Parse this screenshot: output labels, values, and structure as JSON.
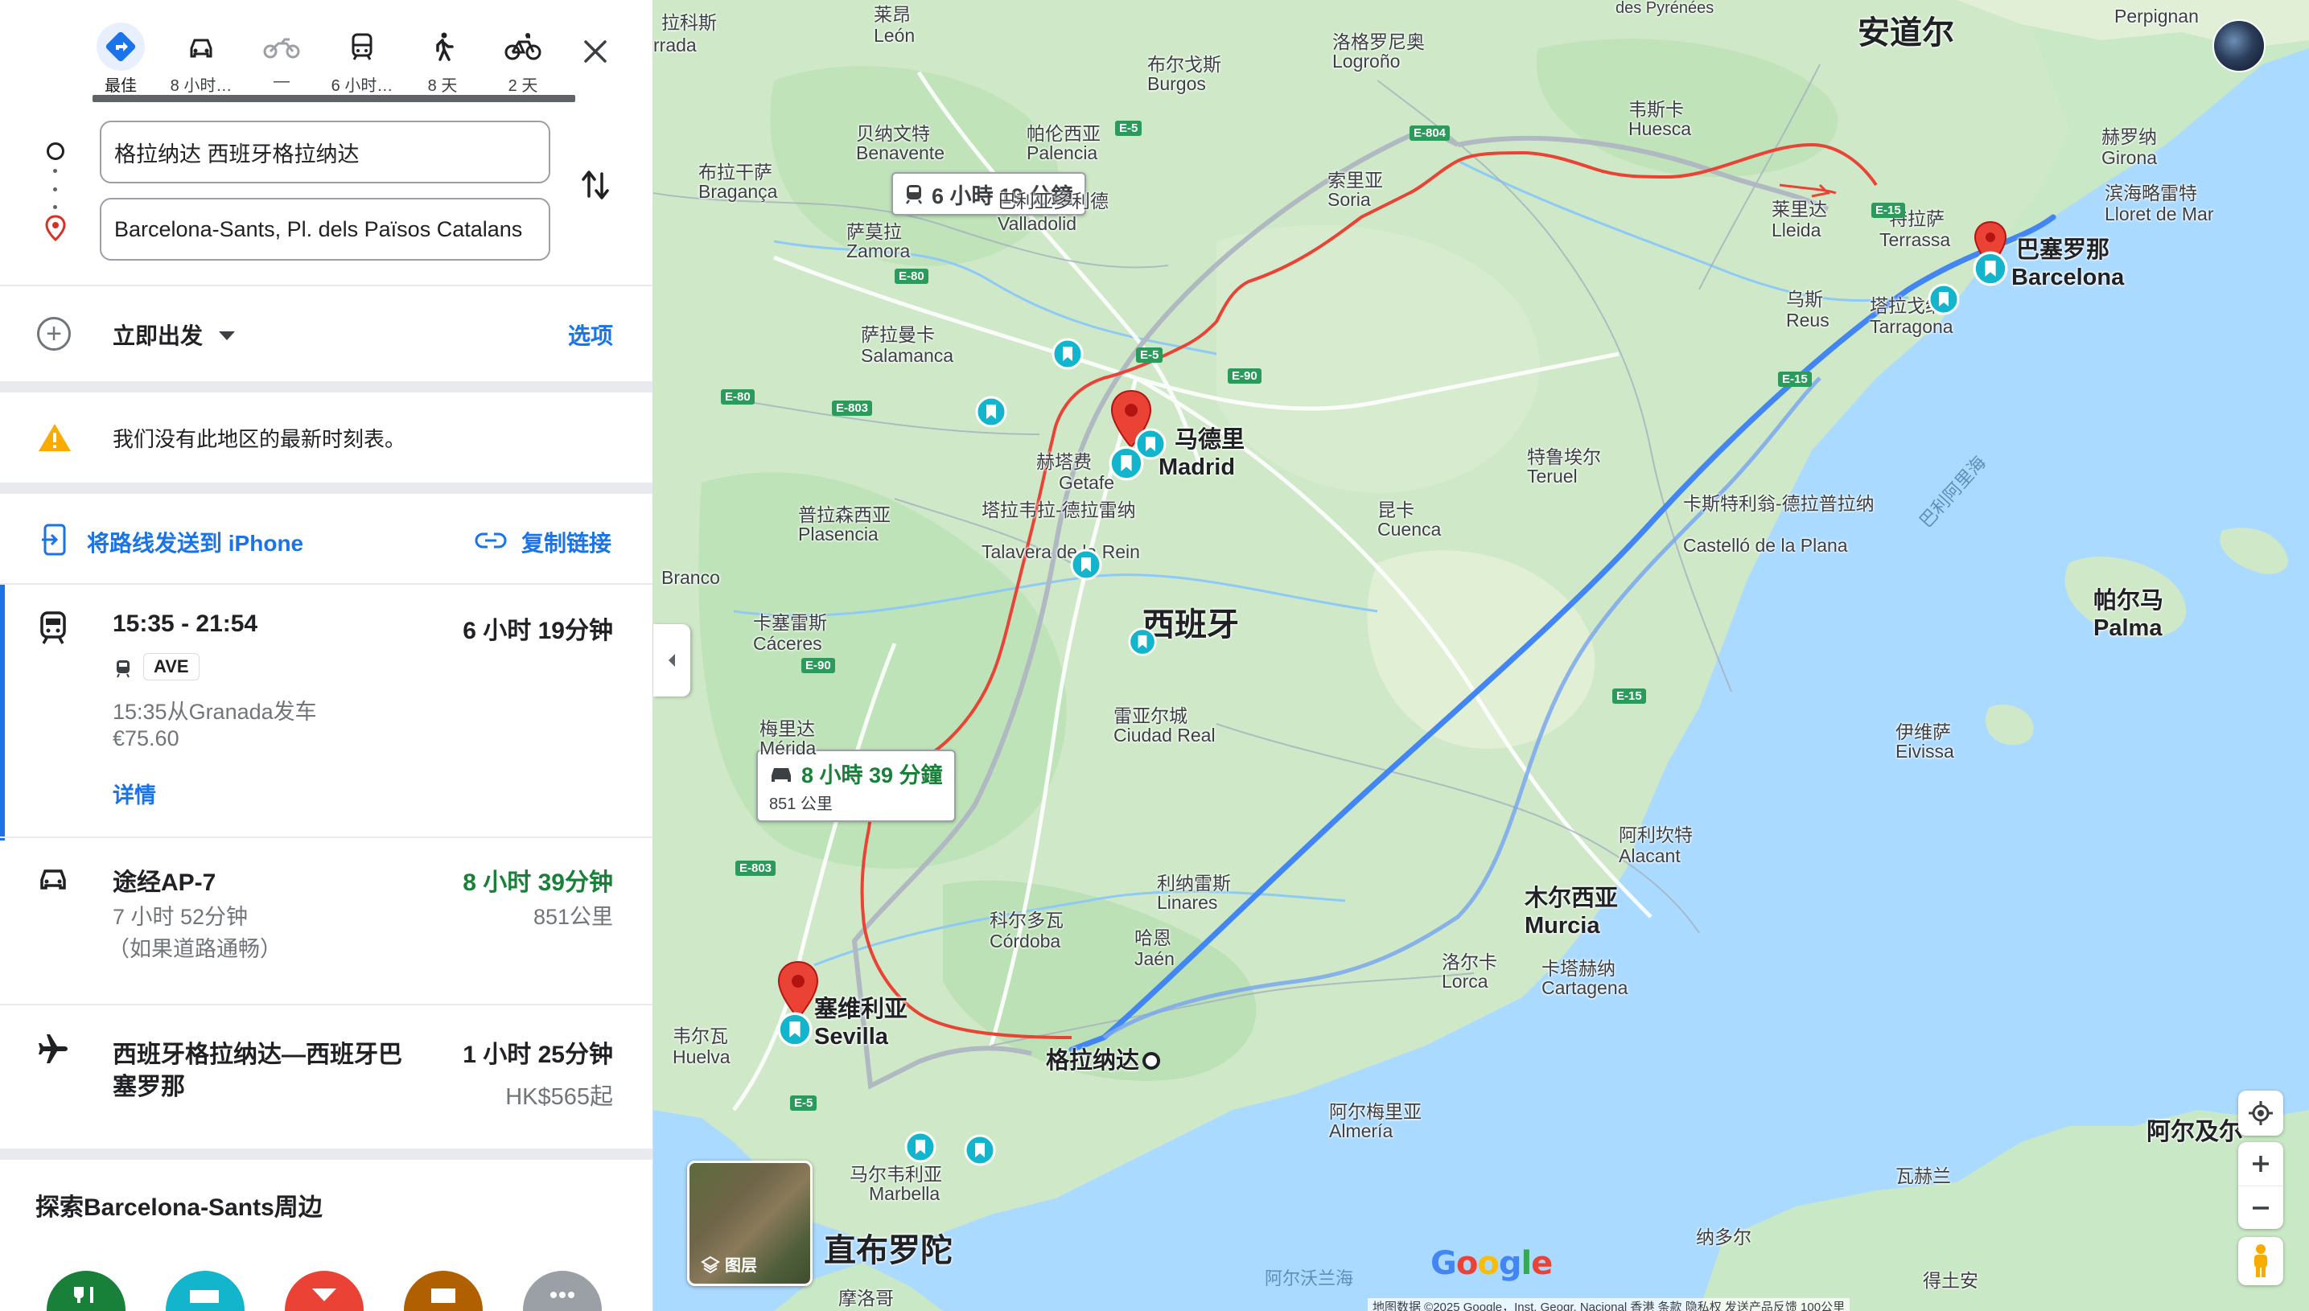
{
  "modes": [
    {
      "label": "最佳",
      "icon": "best-route-icon"
    },
    {
      "label": "8 小时…",
      "icon": "car-icon"
    },
    {
      "label": "—",
      "icon": "motorcycle-icon"
    },
    {
      "label": "6 小时…",
      "icon": "transit-icon"
    },
    {
      "label": "8 天",
      "icon": "walk-icon"
    },
    {
      "label": "2 天",
      "icon": "bicycle-icon"
    }
  ],
  "inputs": {
    "origin": "格拉纳达 西班牙格拉纳达",
    "destination": "Barcelona-Sants, Pl. dels Països Catalans"
  },
  "depart": {
    "label": "立即出发",
    "options_label": "选项"
  },
  "warning": "我们没有此地区的最新时刻表。",
  "share": {
    "send_label": "将路线发送到 iPhone",
    "copy_label": "复制链接"
  },
  "options": [
    {
      "type": "train",
      "title": "15:35 - 21:54",
      "duration": "6 小时 19分钟",
      "badge": "AVE",
      "depart_text": "15:35从Granada发车",
      "price": "€75.60",
      "details_label": "详情"
    },
    {
      "type": "car",
      "title": "途经AP-7",
      "duration": "8 小时 39分钟",
      "sub1": "7 小时 52分钟",
      "sub2": "（如果道路通畅）",
      "distance": "851公里"
    },
    {
      "type": "flight",
      "title_line1": "西班牙格拉纳达—西班牙巴",
      "title_line2": "塞罗那",
      "duration": "1 小时 25分钟",
      "price": "HK$565起"
    }
  ],
  "explore": {
    "title": "探索Barcelona-Sants周边"
  },
  "map": {
    "callout_train": "6 小時 19 分鐘",
    "callout_car_time": "8 小時 39 分鐘",
    "callout_car_distance": "851 公里",
    "layers_label": "图层",
    "attribution": "地图数据 ©2025 Google，Inst. Geogr. Nacional    香港    条款    隐私权    发送产品反馈    100公里",
    "labels": {
      "andorra": "安道尔",
      "spain": "西班牙",
      "gibraltar": "直布罗陀",
      "madrid_cn": "马德里",
      "madrid": "Madrid",
      "barcelona_cn": "巴塞罗那",
      "barcelona": "Barcelona",
      "granada": "格拉纳达",
      "sevilla_cn": "塞维利亚",
      "sevilla": "Sevilla",
      "murcia_cn": "木尔西亚",
      "murcia": "Murcia",
      "palma_cn": "帕尔马",
      "palma": "Palma",
      "valladolid_cn": "巴利亚多利德",
      "valladolid": "Valladolid",
      "cordoba_cn": "科尔多瓦",
      "cordoba": "Córdoba",
      "lleida_cn": "莱里达",
      "lleida": "Lleida",
      "tarragona_cn": "塔拉戈纳",
      "tarragona": "Tarragona",
      "salamanca_cn": "萨拉曼卡",
      "salamanca": "Salamanca",
      "burgos_cn": "布尔戈斯",
      "burgos": "Burgos",
      "logrono_cn": "洛格罗尼奥",
      "logrono": "Logroño",
      "leon_cn": "莱昂",
      "leon": "León",
      "zamora_cn": "萨莫拉",
      "zamora": "Zamora",
      "soria_cn": "索里亚",
      "soria": "Soria",
      "teruel_cn": "特鲁埃尔",
      "teruel": "Teruel",
      "cuenca_cn": "昆卡",
      "cuenca": "Cuenca",
      "castellon_cn": "卡斯特利翁-德拉普拉纳",
      "castellon": "Castelló de la Plana",
      "alacant_cn": "阿利坎特",
      "alacant": "Alacant",
      "lorca_cn": "洛尔卡",
      "lorca": "Lorca",
      "cartagena_cn": "卡塔赫纳",
      "cartagena": "Cartagena",
      "almeria_cn": "阿尔梅里亚",
      "almeria": "Almería",
      "jaen_cn": "哈恩",
      "jaen": "Jaén",
      "linares_cn": "利纳雷斯",
      "linares": "Linares",
      "ciudad_real_cn": "雷亚尔城",
      "ciudad_real": "Ciudad Real",
      "caceres_cn": "卡塞雷斯",
      "caceres": "Cáceres",
      "merida_cn": "梅里达",
      "merida": "Mérida",
      "huelva_cn": "韦尔瓦",
      "huelva": "Huelva",
      "marbella_cn": "马尔韦利亚",
      "marbella": "Marbella",
      "getafe_cn": "赫塔费",
      "getafe": "Getafe",
      "talavera_cn": "塔拉韦拉-德拉雷纳",
      "talavera": "Talavera de la Rein",
      "plasencia_cn": "普拉森西亚",
      "plasencia": "Plasencia",
      "huesca_cn": "韦斯卡",
      "huesca": "Huesca",
      "reus_cn": "乌斯",
      "reus": "Reus",
      "terrassa_cn": "特拉萨",
      "terrassa": "Terrassa",
      "girona_cn": "赫罗纳",
      "girona": "Girona",
      "lloret": "滨海略雷特",
      "lloret_en": "Lloret de Mar",
      "perpignan": "Perpignan",
      "benavente_cn": "贝纳文特",
      "benavente": "Benavente",
      "palencia_cn": "帕伦西亚",
      "palencia": "Palencia",
      "braganca_cn": "布拉干萨",
      "braganca": "Bragança",
      "eivissa_cn": "伊维萨",
      "eivissa": "Eivissa",
      "alboran": "阿尔沃兰海",
      "balearic": "巴利阿里海",
      "nador": "纳多尔",
      "algiers": "阿尔及尔",
      "tetouan": "得土安",
      "oran": "瓦赫兰",
      "morocco_cn": "摩洛哥",
      "pyrenees": "des Pyrénées",
      "branco": "Branco",
      "rada": "rrada",
      "lagos": "拉科斯"
    },
    "road_badges": [
      "E-5",
      "E-804",
      "E-80",
      "E-803",
      "E-80",
      "E-90",
      "E-5",
      "E-90",
      "E-15",
      "E-15",
      "E-15",
      "E-803",
      "E-5"
    ]
  }
}
